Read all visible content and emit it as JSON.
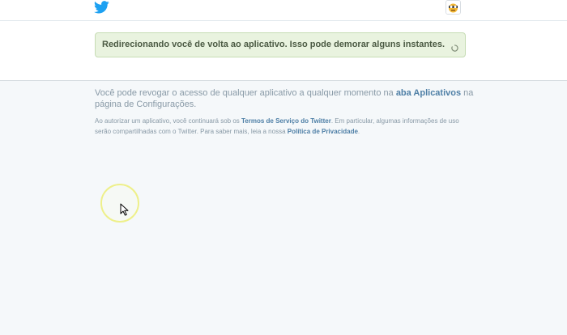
{
  "header": {
    "logo_icon": "twitter-bird-icon",
    "brand_color": "#1da1f2",
    "avatar_icon": "profile-avatar-icon"
  },
  "notice": {
    "text": "Redirecionando você de volta ao aplicativo. Isso pode demorar alguns instantes.",
    "spinner_icon": "loading-spinner-icon",
    "background": "#e9f3df"
  },
  "info": {
    "revoke_prefix": "Você pode revogar o acesso de qualquer aplicativo a qualquer momento na ",
    "apps_tab_link": "aba Aplicativos",
    "revoke_suffix": " na página de Configurações.",
    "terms_prefix": "Ao autorizar um aplicativo, você continuará sob os ",
    "terms_link": "Termos de Serviço do Twitter",
    "terms_middle": ". Em particular, algumas informações de uso serão compartilhadas com o Twitter. Para saber mais, leia a nossa ",
    "privacy_link": "Política de Privacidade",
    "terms_suffix": "."
  },
  "cursor": {
    "icon": "mouse-pointer-icon",
    "highlight_color": "#eef08a"
  }
}
